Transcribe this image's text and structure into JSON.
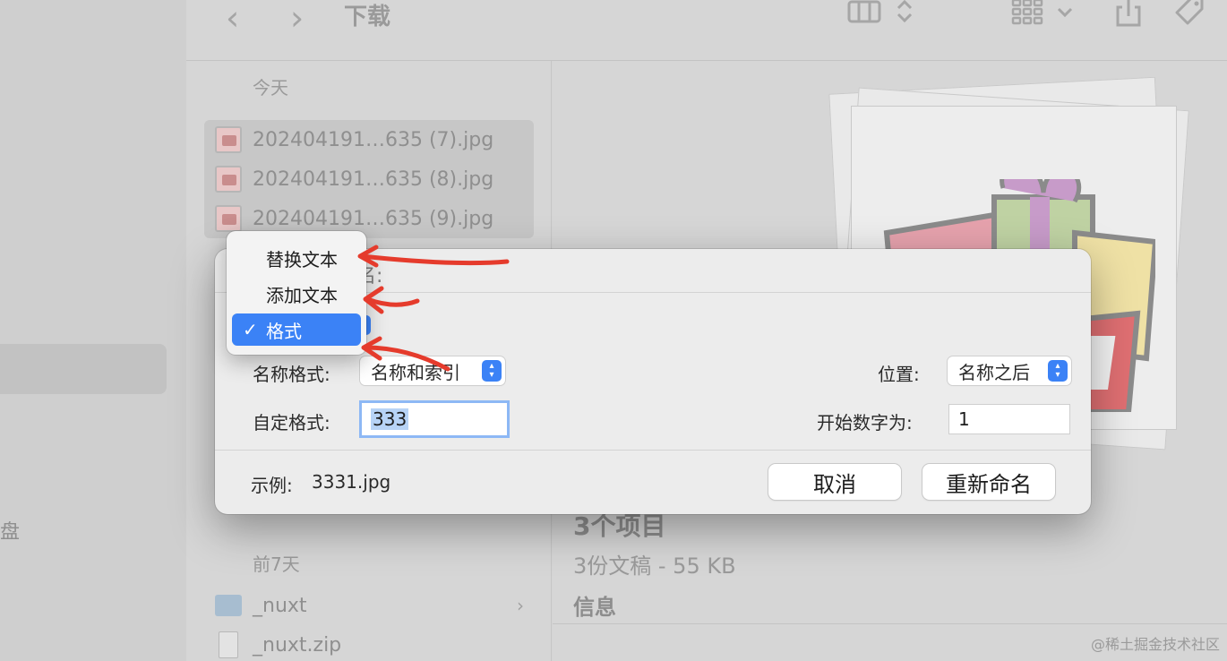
{
  "toolbar": {
    "back_glyph": "‹",
    "forward_glyph": "›",
    "title": "下载"
  },
  "sidebar": {
    "disk_fragment": "盘"
  },
  "list": {
    "today_header": "今天",
    "selected_files": [
      {
        "name": "202404191…635 (7).jpg"
      },
      {
        "name": "202404191…635 (8).jpg"
      },
      {
        "name": "202404191…635 (9).jpg"
      }
    ],
    "past7_header": "前7天",
    "past7_items": [
      {
        "name": "_nuxt",
        "type": "folder"
      },
      {
        "name": "_nuxt.zip",
        "type": "zip"
      }
    ]
  },
  "preview": {
    "count_title": "3个项目",
    "summary": "3份文稿 - 55 KB",
    "info_header": "信息"
  },
  "dialog": {
    "title_partial": "目重新命名:",
    "format_label": "名称格式:",
    "format_value": "名称和索引",
    "custom_label": "自定格式:",
    "custom_value": "333",
    "position_label": "位置:",
    "position_value": "名称之后",
    "start_label": "开始数字为:",
    "start_value": "1",
    "example_label": "示例:",
    "example_value": "3331.jpg",
    "cancel_label": "取消",
    "rename_label": "重新命名"
  },
  "menu": {
    "items": [
      {
        "label": "替换文本",
        "selected": false
      },
      {
        "label": "添加文本",
        "selected": false
      },
      {
        "label": "格式",
        "selected": true
      }
    ],
    "check_glyph": "✓"
  },
  "watermark": "@稀土掘金技术社区",
  "colors": {
    "accent": "#3b82f6",
    "arrow": "#e53b2c"
  },
  "icons": [
    "view-columns-icon",
    "sort-stepper-icon",
    "grid-view-icon",
    "share-icon",
    "tag-icon",
    "folder-icon",
    "zip-icon",
    "chevron-right-icon",
    "checkmark-icon"
  ]
}
